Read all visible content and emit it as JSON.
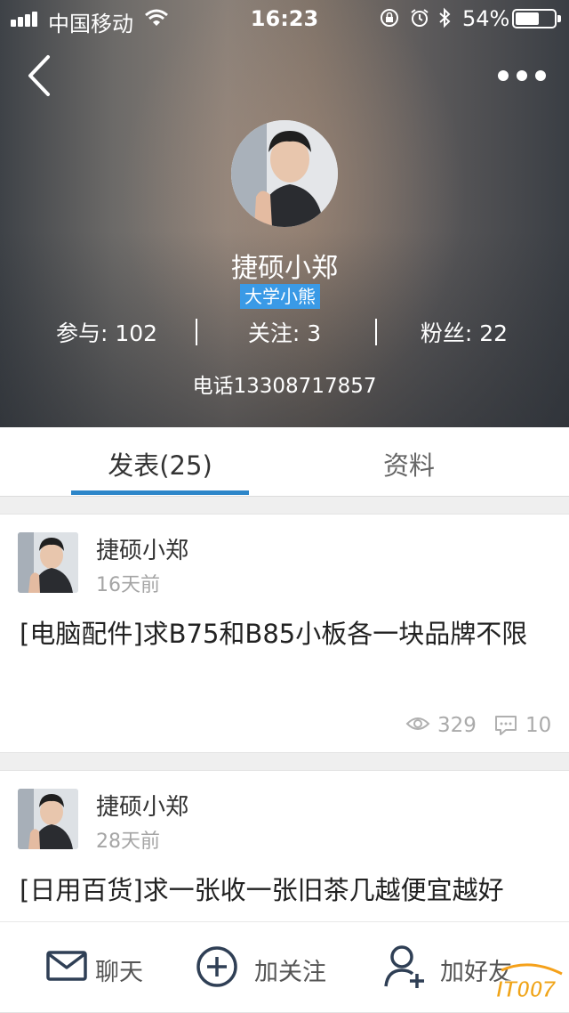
{
  "status_bar": {
    "carrier": "中国移动",
    "time": "16:23",
    "battery": "54%"
  },
  "profile": {
    "name": "捷硕小郑",
    "badge": "大学小熊",
    "stats": [
      {
        "label": "参与: 102"
      },
      {
        "label": "关注: 3"
      },
      {
        "label": "粉丝: 22"
      }
    ],
    "phone": "电话13308717857"
  },
  "tabs": [
    {
      "label": "发表(25)",
      "active": true
    },
    {
      "label": "资料",
      "active": false
    }
  ],
  "posts": [
    {
      "author": "捷硕小郑",
      "time": "16天前",
      "title": "[电脑配件]求B75和B85小板各一块品牌不限",
      "views": "329",
      "comments": "10"
    },
    {
      "author": "捷硕小郑",
      "time": "28天前",
      "title": "[日用百货]求一张收一张旧茶几越便宜越好"
    }
  ],
  "bottom_bar": [
    {
      "label": "聊天",
      "icon": "mail-icon"
    },
    {
      "label": "加关注",
      "icon": "plus-circle-icon"
    },
    {
      "label": "加好友",
      "icon": "add-person-icon"
    }
  ],
  "watermark": "IT007",
  "colors": {
    "accent": "#2d86c9",
    "badge": "#3a9ae6"
  }
}
